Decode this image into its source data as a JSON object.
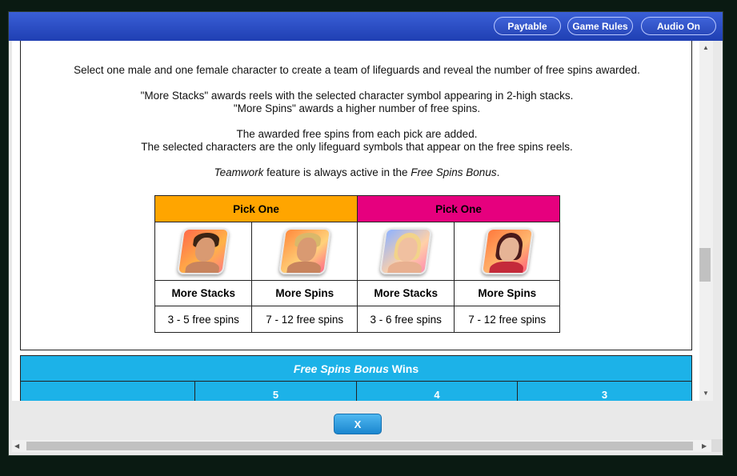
{
  "toolbar": {
    "paytable_label": "Paytable",
    "game_rules_label": "Game Rules",
    "audio_label": "Audio On"
  },
  "content": {
    "para1": "Select one male and one female character to create a team of lifeguards and reveal the number of free spins awarded.",
    "para2a": "\"More Stacks\" awards reels with the selected character symbol appearing in 2-high stacks.",
    "para2b": "\"More Spins\" awards a higher number of free spins.",
    "para3a": "The awarded free spins from each pick are added.",
    "para3b": "The selected characters are the only lifeguard symbols that appear on the free spins reels.",
    "para4_feature": "Teamwork",
    "para4_middle": " feature is always active in the ",
    "para4_bonus": "Free Spins Bonus",
    "para4_end": "."
  },
  "pick_table": {
    "headers": [
      "Pick One",
      "Pick One"
    ],
    "characters": [
      {
        "label": "More Stacks",
        "spins": "3 - 5 free spins",
        "icon": "male-lifeguard-dark-hair-icon"
      },
      {
        "label": "More Spins",
        "spins": "7 - 12 free spins",
        "icon": "male-lifeguard-blond-hair-icon"
      },
      {
        "label": "More Stacks",
        "spins": "3 - 6 free spins",
        "icon": "female-lifeguard-blonde-hair-icon"
      },
      {
        "label": "More Spins",
        "spins": "7 - 12 free spins",
        "icon": "female-lifeguard-dark-hair-icon"
      }
    ]
  },
  "wins_table": {
    "title_italic": "Free Spins Bonus",
    "title_rest": " Wins",
    "columns": [
      "",
      "5",
      "4",
      "3"
    ]
  },
  "dialog": {
    "close_label": "X"
  },
  "colors": {
    "orange_header": "#ffa500",
    "pink_header": "#e6007e",
    "wins_bar": "#1cb2e8",
    "topbar": "#2a49bb"
  }
}
